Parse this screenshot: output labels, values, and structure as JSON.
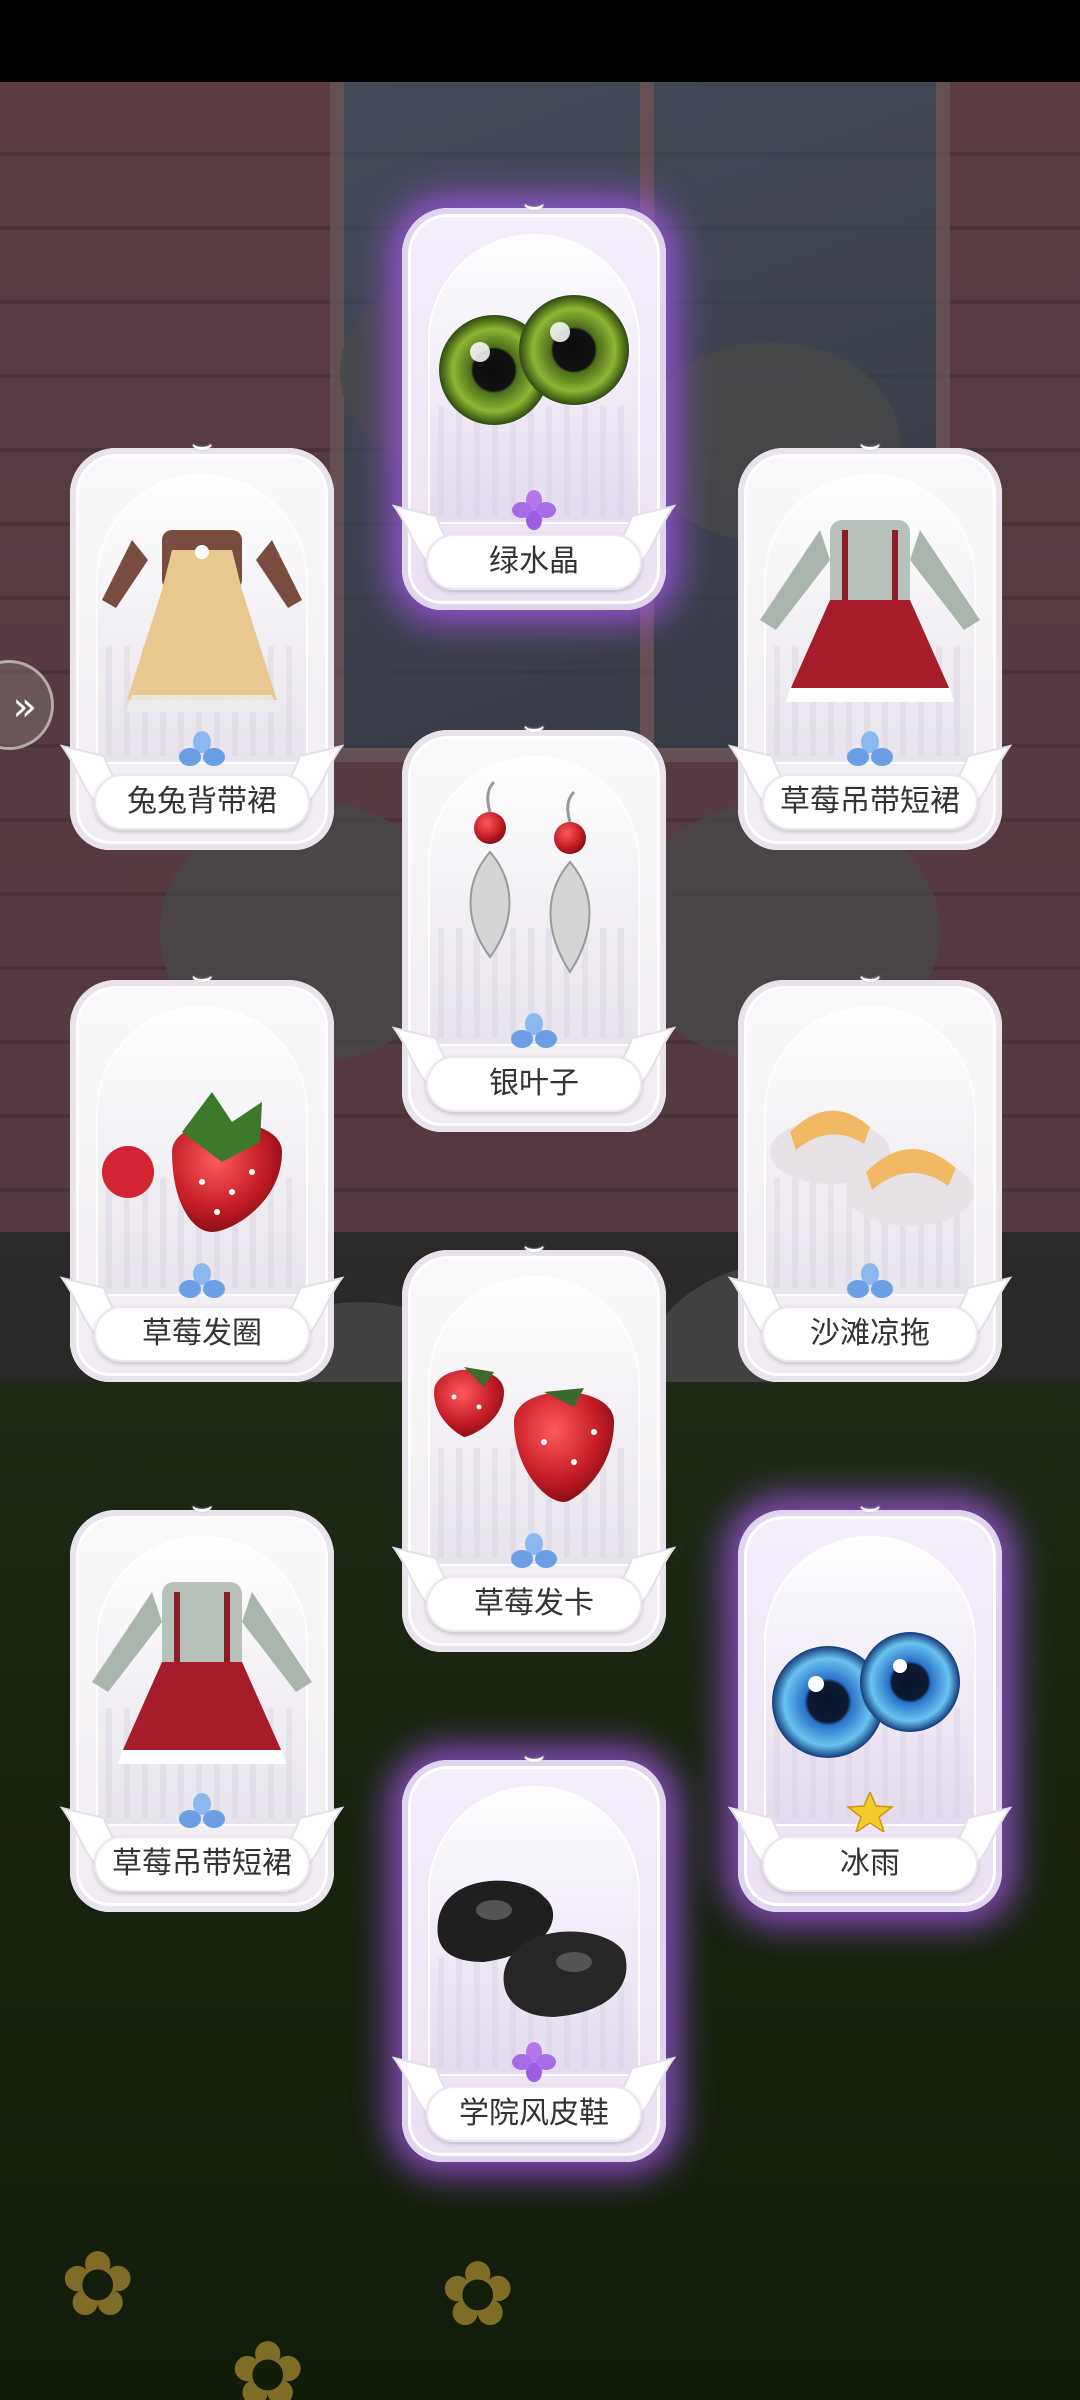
{
  "navigation": {
    "side_arrow_icon": "double-chevron-left"
  },
  "cards": [
    {
      "label": "绿水晶",
      "rarity": "purple",
      "rarity_icon": "purple-flower",
      "item_icon": "green-eye-lens"
    },
    {
      "label": "兔兔背带裙",
      "rarity": "blue",
      "rarity_icon": "blue-flower",
      "item_icon": "rabbit-pinafore-dress"
    },
    {
      "label": "草莓吊带短裙",
      "rarity": "blue",
      "rarity_icon": "blue-flower",
      "item_icon": "strawberry-suspender-skirt"
    },
    {
      "label": "银叶子",
      "rarity": "blue",
      "rarity_icon": "blue-flower",
      "item_icon": "silver-leaf-earrings"
    },
    {
      "label": "草莓发圈",
      "rarity": "blue",
      "rarity_icon": "blue-flower",
      "item_icon": "strawberry-scrunchie"
    },
    {
      "label": "沙滩凉拖",
      "rarity": "blue",
      "rarity_icon": "blue-flower",
      "item_icon": "beach-slippers"
    },
    {
      "label": "草莓发卡",
      "rarity": "blue",
      "rarity_icon": "blue-flower",
      "item_icon": "strawberry-hairpin"
    },
    {
      "label": "草莓吊带短裙",
      "rarity": "blue",
      "rarity_icon": "blue-flower",
      "item_icon": "strawberry-suspender-skirt"
    },
    {
      "label": "冰雨",
      "rarity": "purple",
      "rarity_icon": "gold-star-flower",
      "item_icon": "blue-eye-lens"
    },
    {
      "label": "学院风皮鞋",
      "rarity": "purple",
      "rarity_icon": "purple-flower",
      "item_icon": "black-oxford-shoes"
    }
  ]
}
